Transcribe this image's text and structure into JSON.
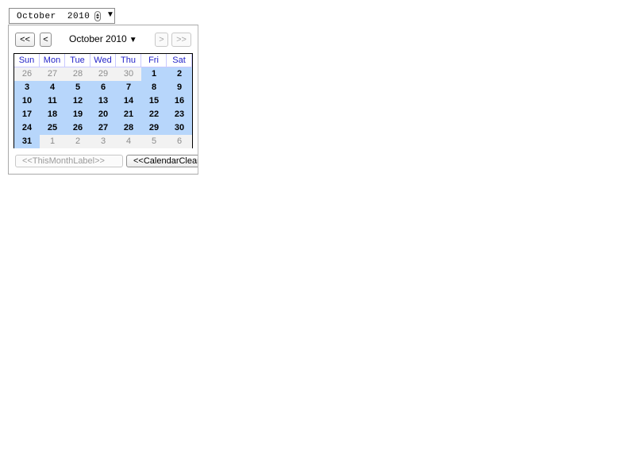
{
  "date_input": {
    "month": "October",
    "year": "2010",
    "spinner_icon": "spinner-icon",
    "dropdown_icon": "triangle-down-icon"
  },
  "calendar": {
    "nav": {
      "prev_year": "<<",
      "prev_month": "<",
      "next_month": ">",
      "next_year": ">>"
    },
    "title": "October 2010",
    "title_caret": "▼",
    "weekdays": [
      "Sun",
      "Mon",
      "Tue",
      "Wed",
      "Thu",
      "Fri",
      "Sat"
    ],
    "weeks": [
      [
        {
          "d": "26",
          "o": true
        },
        {
          "d": "27",
          "o": true
        },
        {
          "d": "28",
          "o": true
        },
        {
          "d": "29",
          "o": true
        },
        {
          "d": "30",
          "o": true
        },
        {
          "d": "1",
          "o": false
        },
        {
          "d": "2",
          "o": false
        }
      ],
      [
        {
          "d": "3",
          "o": false
        },
        {
          "d": "4",
          "o": false
        },
        {
          "d": "5",
          "o": false
        },
        {
          "d": "6",
          "o": false
        },
        {
          "d": "7",
          "o": false
        },
        {
          "d": "8",
          "o": false
        },
        {
          "d": "9",
          "o": false
        }
      ],
      [
        {
          "d": "10",
          "o": false
        },
        {
          "d": "11",
          "o": false
        },
        {
          "d": "12",
          "o": false
        },
        {
          "d": "13",
          "o": false
        },
        {
          "d": "14",
          "o": false
        },
        {
          "d": "15",
          "o": false
        },
        {
          "d": "16",
          "o": false
        }
      ],
      [
        {
          "d": "17",
          "o": false
        },
        {
          "d": "18",
          "o": false
        },
        {
          "d": "19",
          "o": false
        },
        {
          "d": "20",
          "o": false
        },
        {
          "d": "21",
          "o": false
        },
        {
          "d": "22",
          "o": false
        },
        {
          "d": "23",
          "o": false
        }
      ],
      [
        {
          "d": "24",
          "o": false
        },
        {
          "d": "25",
          "o": false
        },
        {
          "d": "26",
          "o": false
        },
        {
          "d": "27",
          "o": false
        },
        {
          "d": "28",
          "o": false
        },
        {
          "d": "29",
          "o": false
        },
        {
          "d": "30",
          "o": false
        }
      ],
      [
        {
          "d": "31",
          "o": false
        },
        {
          "d": "1",
          "o": true
        },
        {
          "d": "2",
          "o": true
        },
        {
          "d": "3",
          "o": true
        },
        {
          "d": "4",
          "o": true
        },
        {
          "d": "5",
          "o": true
        },
        {
          "d": "6",
          "o": true
        }
      ]
    ],
    "this_month_label": "<<ThisMonthLabel>>",
    "clear_label": "<<CalendarClearLabel>>"
  },
  "colors": {
    "header_text": "#2323c8",
    "current_month_bg": "#b7d6fb",
    "other_month_bg": "#f2f2f2",
    "other_month_text": "#8c8c8c"
  }
}
